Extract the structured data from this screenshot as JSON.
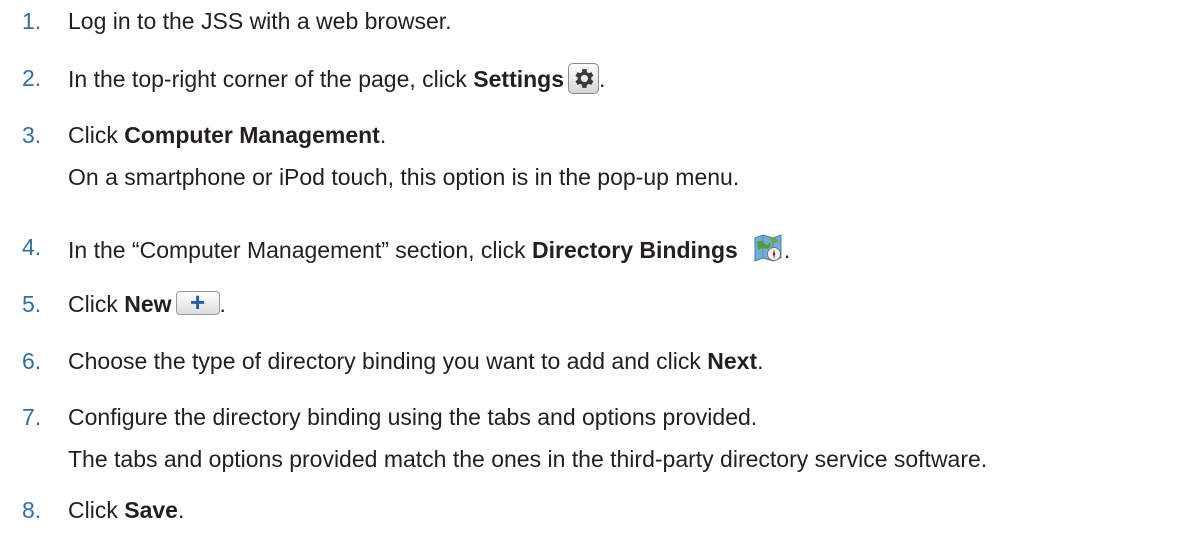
{
  "steps": [
    {
      "num": "1.",
      "text": "Log in to the JSS with a web browser."
    },
    {
      "num": "2.",
      "pre": "In the top-right corner of the page, click ",
      "bold": "Settings",
      "icon": "gear-icon",
      "post": "."
    },
    {
      "num": "3.",
      "pre": "Click ",
      "bold": "Computer Management",
      "post": ".",
      "note": "On a smartphone or iPod touch, this option is in the pop-up menu."
    },
    {
      "num": "4.",
      "pre": "In the “Computer Management” section, click ",
      "bold": "Directory Bindings",
      "icon": "directory-bindings-icon",
      "post": "."
    },
    {
      "num": "5.",
      "pre": "Click ",
      "bold": "New",
      "icon": "plus-icon",
      "post": "."
    },
    {
      "num": "6.",
      "pre": "Choose the type of directory binding you want to add and click ",
      "bold": "Next",
      "post": "."
    },
    {
      "num": "7.",
      "text": "Configure the directory binding using the tabs and options provided.",
      "note": "The tabs and options provided match the ones in the third-party directory service software."
    },
    {
      "num": "8.",
      "pre": "Click ",
      "bold": "Save",
      "post": "."
    }
  ],
  "colors": {
    "step_number": "#2e6fa7",
    "text": "#231f20",
    "plus_icon": "#1f5fa8"
  }
}
